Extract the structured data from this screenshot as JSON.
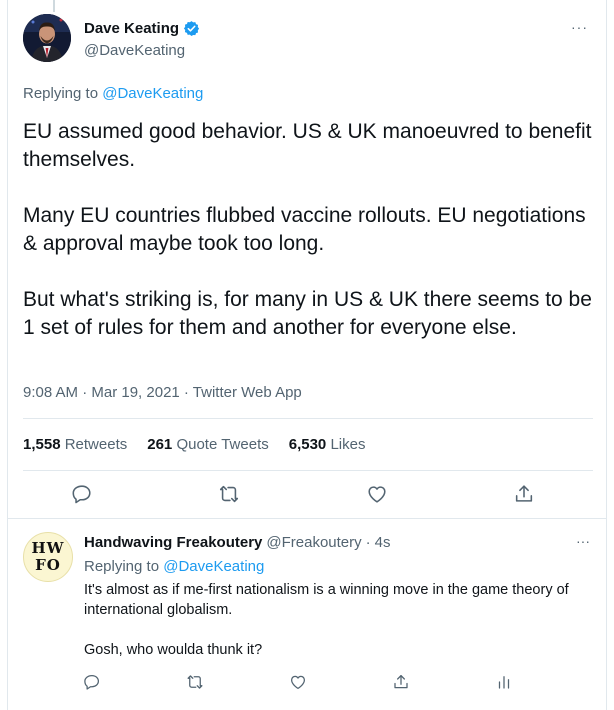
{
  "tweet": {
    "author": {
      "display_name": "Dave Keating",
      "handle": "@DaveKeating",
      "verified": true,
      "avatar": "avatar-photo"
    },
    "replying_to_prefix": "Replying to",
    "replying_to_handle": "@DaveKeating",
    "paragraphs": [
      "EU assumed good behavior. US & UK manoeuvred to benefit themselves.",
      "Many EU countries flubbed vaccine rollouts. EU negotiations & approval maybe took too long.",
      "But what's striking is, for many in US & UK there seems to be 1 set of rules for them and another for everyone else."
    ],
    "meta": "9:08 AM · Mar 19, 2021 · Twitter Web App",
    "stats": {
      "retweets_count": "1,558",
      "retweets_label": "Retweets",
      "quotes_count": "261",
      "quotes_label": "Quote Tweets",
      "likes_count": "6,530",
      "likes_label": "Likes"
    },
    "actions": [
      "reply-icon",
      "retweet-icon",
      "like-icon",
      "share-icon"
    ]
  },
  "reply": {
    "avatar_text_top": "HW",
    "avatar_text_bottom": "FO",
    "display_name": "Handwaving Freakoutery",
    "handle": "@Freakoutery",
    "separator": "·",
    "time": "4s",
    "replying_to_prefix": "Replying to",
    "replying_to_handle": "@DaveKeating",
    "paragraphs": [
      "It's almost as if me-first nationalism is a winning move in the game theory of international globalism.",
      "Gosh, who woulda thunk it?"
    ],
    "actions": [
      "reply-icon",
      "retweet-icon",
      "like-icon",
      "share-icon",
      "analytics-icon"
    ]
  },
  "colors": {
    "accent": "#1d9bf0",
    "text_primary": "#0f1419",
    "text_secondary": "#536471",
    "divider": "#e1e8ed"
  },
  "icons": {
    "more": "···"
  }
}
